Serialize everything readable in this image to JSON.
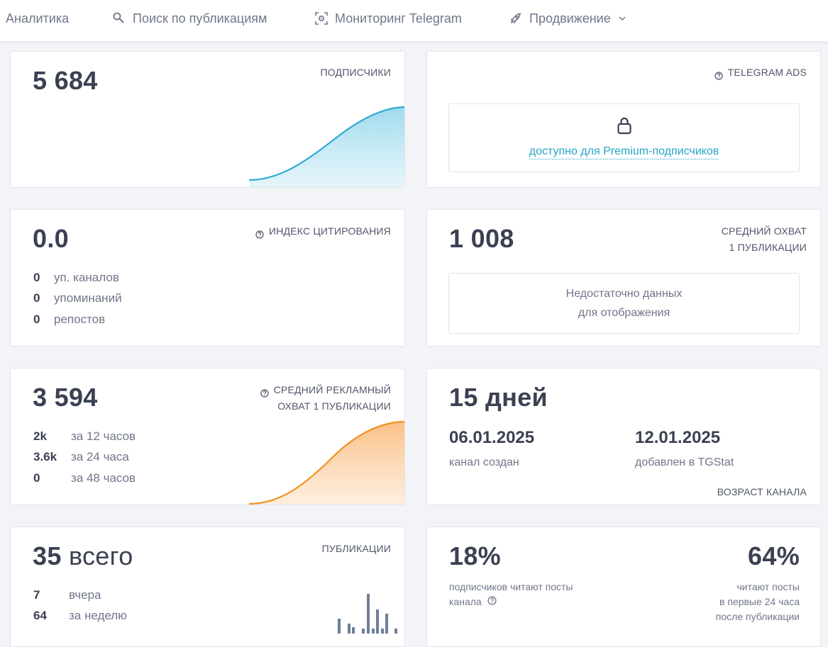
{
  "nav": {
    "analytics": "Аналитика",
    "search": "Поиск по публикациям",
    "monitoring": "Мониторинг Telegram",
    "promotion": "Продвижение"
  },
  "subscribers": {
    "value": "5 684",
    "caption": "ПОДПИСЧИКИ",
    "curve_color": "#2fabd1"
  },
  "ads": {
    "caption": "TELEGRAM ADS",
    "lock_text": "доступно для Premium-подписчиков"
  },
  "citation": {
    "value": "0.0",
    "caption": "ИНДЕКС ЦИТИРОВАНИЯ",
    "rows": [
      {
        "num": "0",
        "label": "уп. каналов"
      },
      {
        "num": "0",
        "label": "упоминаний"
      },
      {
        "num": "0",
        "label": "репостов"
      }
    ]
  },
  "reach": {
    "value": "1 008",
    "caption_line1": "СРЕДНИЙ ОХВАТ",
    "caption_line2": "1 ПУБЛИКАЦИИ",
    "note_line1": "Недостаточно данных",
    "note_line2": "для отображения"
  },
  "ad_reach": {
    "value": "3 594",
    "caption_line1": "СРЕДНИЙ РЕКЛАМНЫЙ",
    "caption_line2": "ОХВАТ 1 ПУБЛИКАЦИИ",
    "rows": [
      {
        "num": "2k",
        "label": "за 12 часов"
      },
      {
        "num": "3.6k",
        "label": "за 24 часа"
      },
      {
        "num": "0",
        "label": "за 48 часов"
      }
    ],
    "curve_color": "#f0921f"
  },
  "age": {
    "value": "15 дней",
    "created_date": "06.01.2025",
    "created_label": "канал создан",
    "added_date": "12.01.2025",
    "added_label": "добавлен в TGStat",
    "caption": "ВОЗРАСТ КАНАЛА"
  },
  "posts": {
    "value_num": "35",
    "value_word": "всего",
    "caption": "ПУБЛИКАЦИИ",
    "rows": [
      {
        "num": "7",
        "label": "вчера"
      },
      {
        "num": "64",
        "label": "за неделю"
      },
      {
        "num": "",
        "label": ""
      }
    ],
    "bar_color": "#6e7f96"
  },
  "readers": {
    "pct_subscribers": "18%",
    "pct_subscribers_label_line1": "подписчиков читают посты",
    "pct_subscribers_label_line2": "канала",
    "pct_24h": "64%",
    "pct_24h_label_line1": "читают посты",
    "pct_24h_label_line2": "в первые 24 часа",
    "pct_24h_label_line3": "после публикации"
  }
}
